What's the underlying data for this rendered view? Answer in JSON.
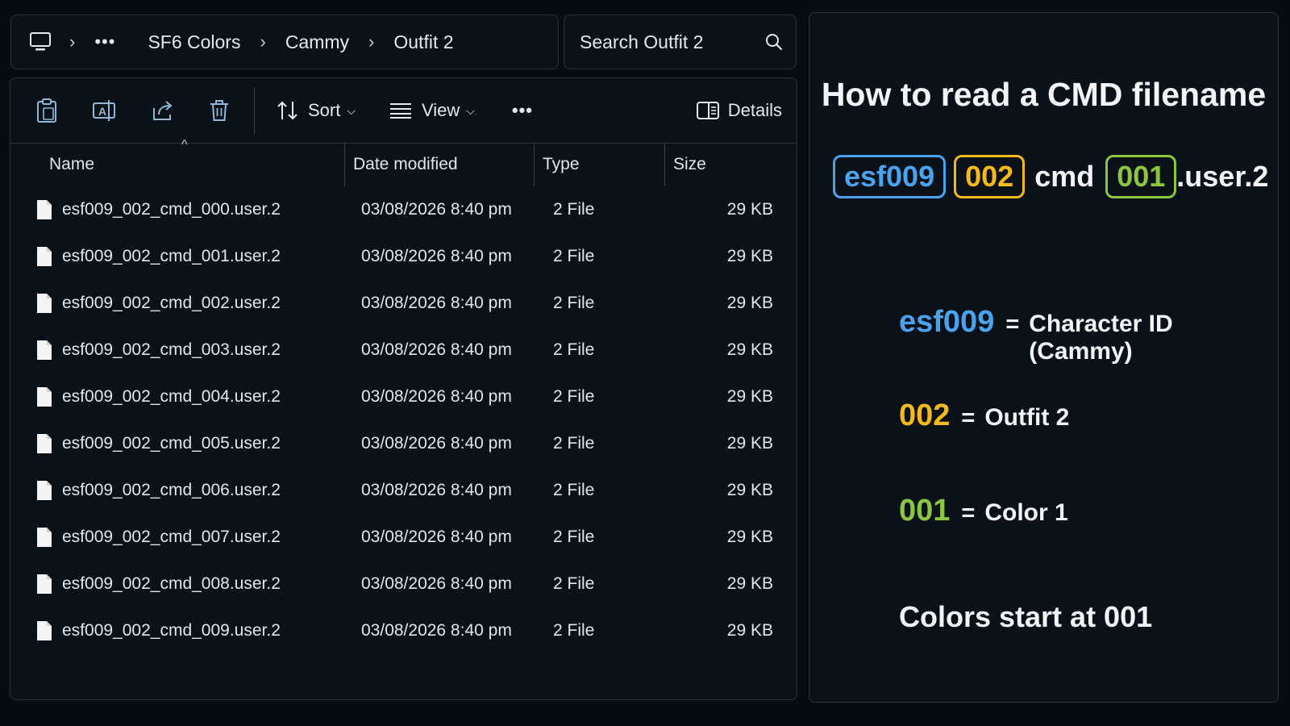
{
  "colors": {
    "blue": "#4aa3ee",
    "yellow": "#f5b91c",
    "green": "#8cc540"
  },
  "address_bar": {
    "ellipsis": "•••",
    "crumbs": [
      "SF6 Colors",
      "Cammy",
      "Outfit 2"
    ]
  },
  "search": {
    "placeholder": "Search Outfit 2"
  },
  "toolbar": {
    "sort_label": "Sort",
    "view_label": "View",
    "more_label": "•••",
    "details_label": "Details"
  },
  "columns": {
    "name": "Name",
    "date": "Date modified",
    "type": "Type",
    "size": "Size"
  },
  "files": [
    {
      "name": "esf009_002_cmd_000.user.2",
      "date": "03/08/2026 8:40 pm",
      "type": "2 File",
      "size": "29 KB"
    },
    {
      "name": "esf009_002_cmd_001.user.2",
      "date": "03/08/2026 8:40 pm",
      "type": "2 File",
      "size": "29 KB"
    },
    {
      "name": "esf009_002_cmd_002.user.2",
      "date": "03/08/2026 8:40 pm",
      "type": "2 File",
      "size": "29 KB"
    },
    {
      "name": "esf009_002_cmd_003.user.2",
      "date": "03/08/2026 8:40 pm",
      "type": "2 File",
      "size": "29 KB"
    },
    {
      "name": "esf009_002_cmd_004.user.2",
      "date": "03/08/2026 8:40 pm",
      "type": "2 File",
      "size": "29 KB"
    },
    {
      "name": "esf009_002_cmd_005.user.2",
      "date": "03/08/2026 8:40 pm",
      "type": "2 File",
      "size": "29 KB"
    },
    {
      "name": "esf009_002_cmd_006.user.2",
      "date": "03/08/2026 8:40 pm",
      "type": "2 File",
      "size": "29 KB"
    },
    {
      "name": "esf009_002_cmd_007.user.2",
      "date": "03/08/2026 8:40 pm",
      "type": "2 File",
      "size": "29 KB"
    },
    {
      "name": "esf009_002_cmd_008.user.2",
      "date": "03/08/2026 8:40 pm",
      "type": "2 File",
      "size": "29 KB"
    },
    {
      "name": "esf009_002_cmd_009.user.2",
      "date": "03/08/2026 8:40 pm",
      "type": "2 File",
      "size": "29 KB"
    }
  ],
  "info": {
    "title": "How to read a CMD filename",
    "filename_parts": {
      "char": "esf009",
      "outfit": "002",
      "cmd": "cmd",
      "color": "001",
      "ext": ".user.2"
    },
    "legend": [
      {
        "code": "esf009",
        "eq": "=",
        "desc": "Character ID (Cammy)"
      },
      {
        "code": "002",
        "eq": "=",
        "desc": "Outfit 2"
      },
      {
        "code": "001",
        "eq": "=",
        "desc": "Color 1"
      }
    ],
    "note": "Colors start at 001"
  }
}
